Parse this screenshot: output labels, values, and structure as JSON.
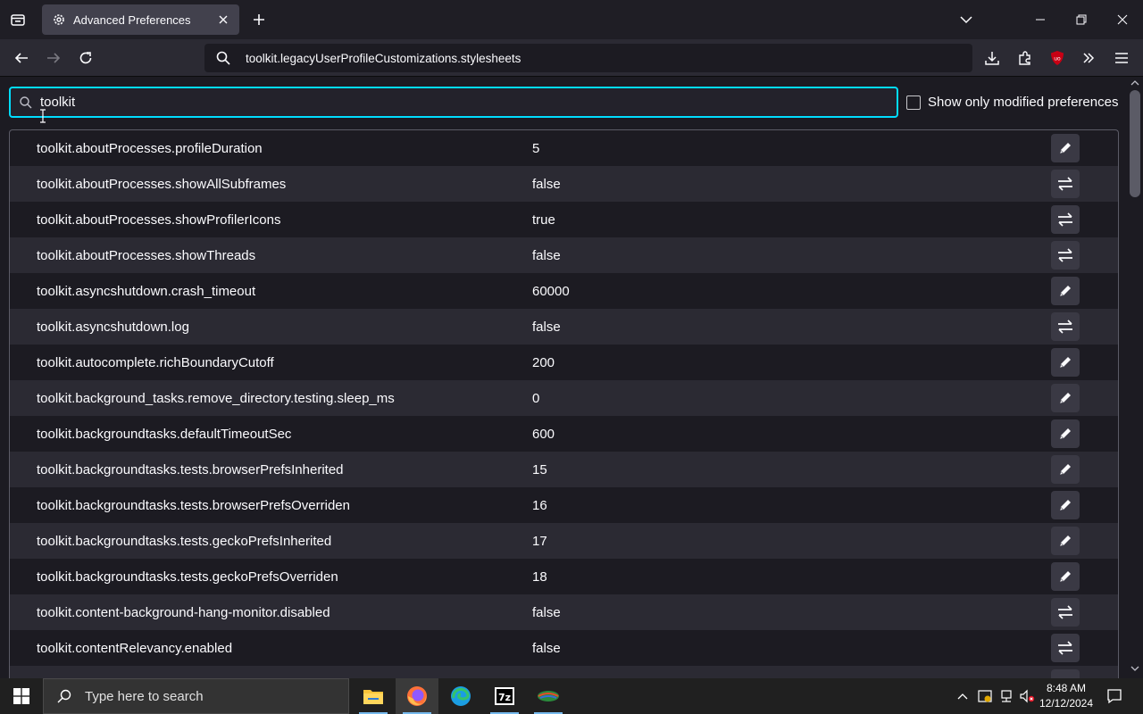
{
  "browser": {
    "tab_title": "Advanced Preferences",
    "url": "toolkit.legacyUserProfileCustomizations.stylesheets"
  },
  "prefs": {
    "search_value": "toolkit",
    "show_modified_label": "Show only modified preferences",
    "rows": [
      {
        "name": "toolkit.aboutProcesses.profileDuration",
        "value": "5",
        "action": "edit"
      },
      {
        "name": "toolkit.aboutProcesses.showAllSubframes",
        "value": "false",
        "action": "toggle"
      },
      {
        "name": "toolkit.aboutProcesses.showProfilerIcons",
        "value": "true",
        "action": "toggle"
      },
      {
        "name": "toolkit.aboutProcesses.showThreads",
        "value": "false",
        "action": "toggle"
      },
      {
        "name": "toolkit.asyncshutdown.crash_timeout",
        "value": "60000",
        "action": "edit"
      },
      {
        "name": "toolkit.asyncshutdown.log",
        "value": "false",
        "action": "toggle"
      },
      {
        "name": "toolkit.autocomplete.richBoundaryCutoff",
        "value": "200",
        "action": "edit"
      },
      {
        "name": "toolkit.background_tasks.remove_directory.testing.sleep_ms",
        "value": "0",
        "action": "edit"
      },
      {
        "name": "toolkit.backgroundtasks.defaultTimeoutSec",
        "value": "600",
        "action": "edit"
      },
      {
        "name": "toolkit.backgroundtasks.tests.browserPrefsInherited",
        "value": "15",
        "action": "edit"
      },
      {
        "name": "toolkit.backgroundtasks.tests.browserPrefsOverriden",
        "value": "16",
        "action": "edit"
      },
      {
        "name": "toolkit.backgroundtasks.tests.geckoPrefsInherited",
        "value": "17",
        "action": "edit"
      },
      {
        "name": "toolkit.backgroundtasks.tests.geckoPrefsOverriden",
        "value": "18",
        "action": "edit"
      },
      {
        "name": "toolkit.content-background-hang-monitor.disabled",
        "value": "false",
        "action": "toggle"
      },
      {
        "name": "toolkit.contentRelevancy.enabled",
        "value": "false",
        "action": "toggle"
      },
      {
        "name": "",
        "value": "",
        "action": "edit"
      }
    ]
  },
  "taskbar": {
    "search_placeholder": "Type here to search",
    "time": "8:48 AM",
    "date": "12/12/2024",
    "apps": [
      "file-explorer",
      "firefox",
      "edge",
      "7zip",
      "other-app"
    ]
  },
  "colors": {
    "accent": "#00ddff",
    "ublock": "#c80014"
  }
}
